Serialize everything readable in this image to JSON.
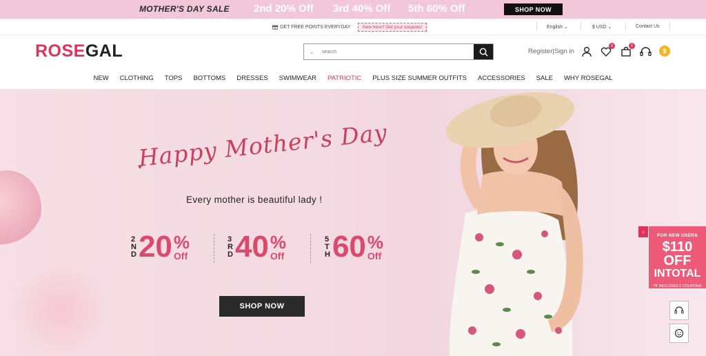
{
  "promo": {
    "title": "MOTHER'S DAY SALE",
    "offers": [
      "2nd 20% Off",
      "3rd 40% Off",
      "5th 60% Off"
    ],
    "shop_label": "SHOP NOW"
  },
  "util": {
    "points": "GET FREE POINTS EVERYDAY",
    "coupon": "New here? Get your coupons!",
    "language": "English",
    "currency": "$ USD",
    "contact": "Contact Us"
  },
  "header": {
    "logo_a": "ROSE",
    "logo_b": "GAL",
    "search_placeholder": "search",
    "register": "Register",
    "signin": "Sign in",
    "wishlist_count": "0",
    "cart_count": "0"
  },
  "nav": [
    "NEW",
    "CLOTHING",
    "TOPS",
    "BOTTOMS",
    "DRESSES",
    "SWIMWEAR",
    "PATRIOTIC",
    "PLUS SIZE SUMMER OUTFITS",
    "ACCESSORIES",
    "SALE",
    "WHY ROSEGAL"
  ],
  "hero": {
    "script": "Happy Mother's Day",
    "tagline": "Every mother is beautiful lady !",
    "deals": [
      {
        "ord": [
          "2",
          "N",
          "D"
        ],
        "value": "20",
        "pct": "%",
        "off": "Off"
      },
      {
        "ord": [
          "3",
          "R",
          "D"
        ],
        "value": "40",
        "pct": "%",
        "off": "Off"
      },
      {
        "ord": [
          "5",
          "T",
          "H"
        ],
        "value": "60",
        "pct": "%",
        "off": "Off"
      }
    ],
    "button": "SHOP NOW"
  },
  "side_promo": {
    "line1": "FOR NEW USERS",
    "line2": "$110 OFF",
    "line3": "INTOTAL",
    "line4": "*IT INCLUDES 5 COUPONS"
  },
  "colors": {
    "brand": "#e0335c",
    "promo_bg": "#f2c7d7",
    "dark": "#1b1b1b"
  }
}
